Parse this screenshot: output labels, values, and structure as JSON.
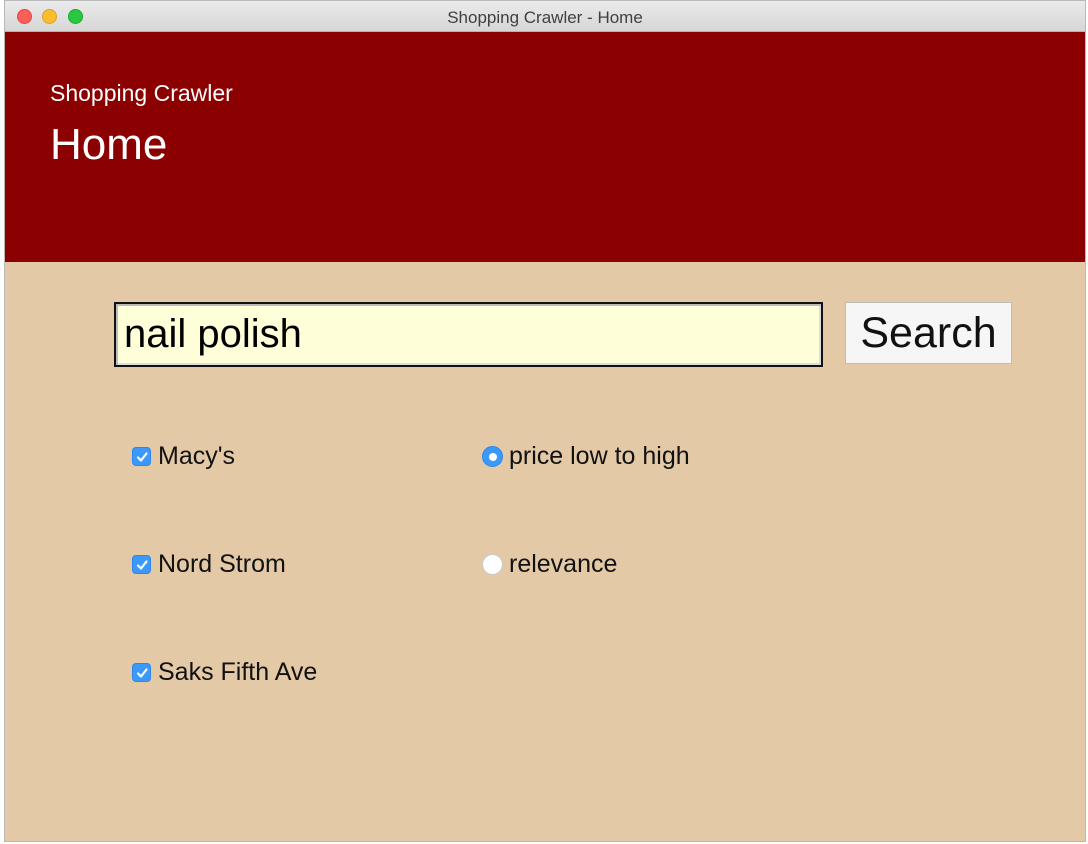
{
  "window": {
    "title": "Shopping Crawler - Home"
  },
  "header": {
    "app_name": "Shopping Crawler",
    "page_title": "Home"
  },
  "search": {
    "value": "nail polish",
    "button_label": "Search"
  },
  "stores": [
    {
      "label": "Macy's",
      "checked": true
    },
    {
      "label": "Nord Strom",
      "checked": true
    },
    {
      "label": "Saks Fifth Ave",
      "checked": true
    }
  ],
  "sort_options": [
    {
      "label": "price low to high",
      "selected": true
    },
    {
      "label": "relevance",
      "selected": false
    }
  ],
  "colors": {
    "header_bg": "#8b0000",
    "content_bg": "#e3c9a5",
    "accent": "#3b99fc",
    "input_bg": "#fefed8"
  }
}
